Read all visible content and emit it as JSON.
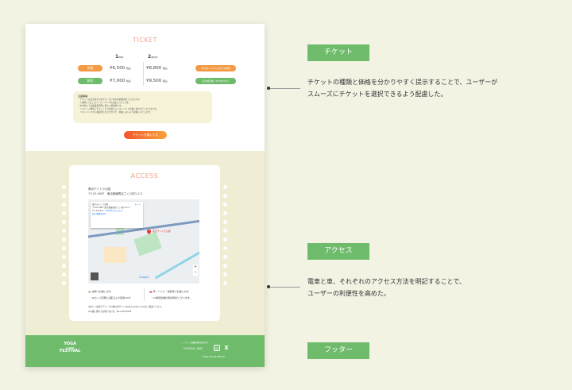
{
  "ticket": {
    "title": "TICKET",
    "day1": {
      "num": "1",
      "unit": "day"
    },
    "day2": {
      "num": "2",
      "unit": "days"
    },
    "rows": [
      {
        "label": "早割",
        "p1": "¥6,500",
        "p2": "¥8,800",
        "tax": "税込",
        "badge": "3/6(金)~3/31(火)までの期間",
        "color": "#f39a44"
      },
      {
        "label": "前売",
        "p1": "¥7,000",
        "p2": "¥9,500",
        "tax": "税込",
        "badge": "完全前売制！4/30(木)まで",
        "color": "#6fbb6c"
      }
    ],
    "notes_title": "注意事項",
    "notes": [
      "・チケットは完全前売り制です。売り切れ次第販売終了となります。",
      "・入場時に1日ごとにリストバンドをお渡しいたします。",
      "・中学生以下は保護者同伴に限り入場無料です。",
      "・イベント入場時にチケットと引き換えにリストバンドを腕に巻かせていただきます。",
      "　リストバンドが入場証明となりますので、紛失しないようお願いいたします。"
    ],
    "buy_label": "チケットを購入する"
  },
  "access": {
    "title": "ACCESS",
    "name": "東京デイトラ公園",
    "address": "〒123-4567　東京都練馬区さくら町1-2-3",
    "map": {
      "info_name": "東京デイトラ公園",
      "info_addr": "〒123-4567 東京都練馬区さくら町1-2-3",
      "route": "ルート",
      "rating": "4.1 ★★★★☆",
      "reviews": "(567件のクチコミ)",
      "larger_map": "拡大地図を表示",
      "pin_label": "東京デイトラ公園",
      "zoom_in": "+",
      "zoom_out": "−",
      "brand": "Google"
    },
    "train_title": "電車でお越しの方",
    "train_text": "・JRさくら町駅(公園口)より徒歩10分",
    "car_title": "車・バイク・自転車でお越しの方",
    "car_text": "・24時間営業の駐車場がございます。",
    "note1": "※詳しくは東京デイトラ公園公式サイト(daytora-park.com)をご確認ください。",
    "note2": "※公園に関するお問い合わせ：00-1234-5678"
  },
  "footer": {
    "logo": [
      "YOGA",
      "in 2024",
      "FESTIVAL"
    ],
    "sns_caption": "＼ イベントの最新情報を発信中！ ／",
    "sns_label": "OFFICIAL SNS",
    "instagram": "instagram-icon",
    "x": "X",
    "copyright": "© 2024 YOGA IN FESTIVAL"
  },
  "annotations": [
    {
      "label": "チケット",
      "text": [
        "チケットの種類と価格を分かりやすく提示することで、ユーザーが",
        "スムーズにチケットを選択できるよう配慮した。"
      ]
    },
    {
      "label": "アクセス",
      "text": [
        "電車と車、それぞれのアクセス方法を明記することで、",
        "ユーザーの利便性を高めた。"
      ]
    },
    {
      "label": "フッター"
    }
  ],
  "colors": {
    "accent_green": "#6fbb6c",
    "accent_orange": "#f39a44",
    "title_pink": "#f3a48a",
    "background": "#f3f3e4"
  }
}
